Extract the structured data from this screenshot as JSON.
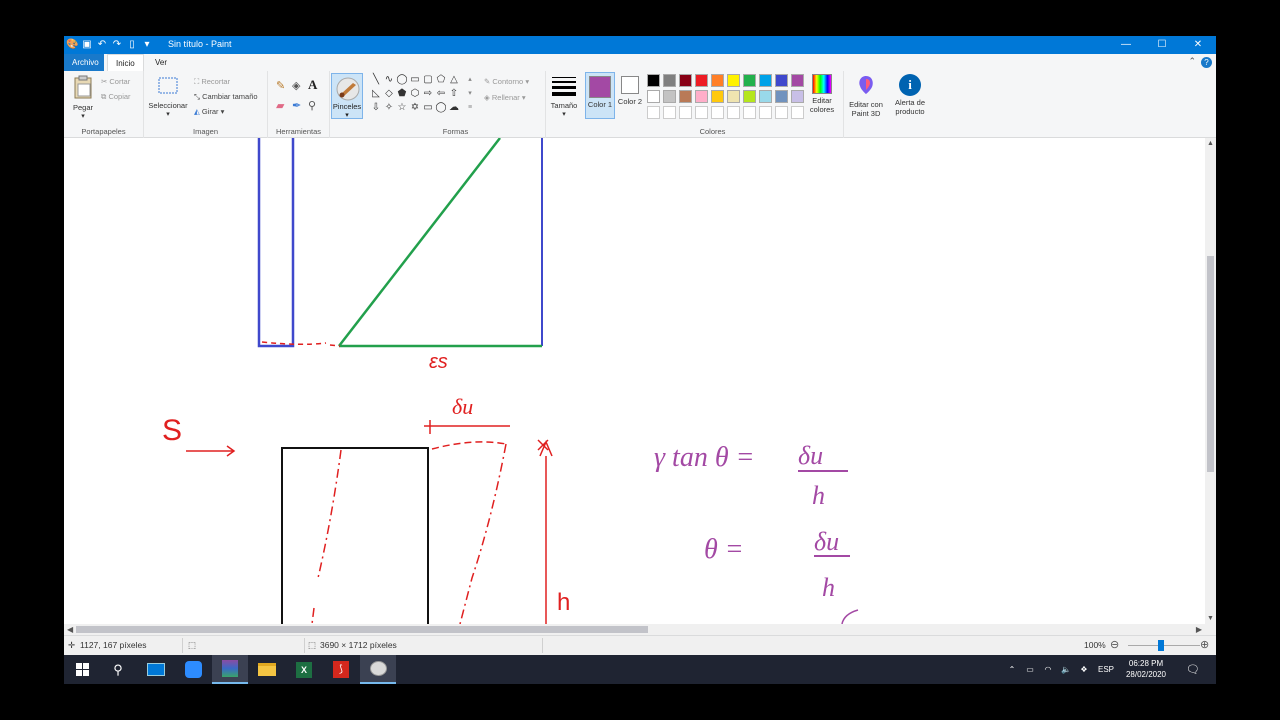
{
  "window": {
    "title": "Sin título - Paint",
    "buttons": {
      "minimize": "—",
      "maximize": "☐",
      "close": "✕"
    }
  },
  "tabs": {
    "file": "Archivo",
    "home": "Inicio",
    "view": "Ver"
  },
  "ribbon": {
    "clipboard": {
      "paste": "Pegar",
      "cut": "Cortar",
      "copy": "Copiar",
      "label": "Portapapeles"
    },
    "image": {
      "select": "Seleccionar",
      "crop": "Recortar",
      "resize": "Cambiar tamaño",
      "rotate": "Girar",
      "label": "Imagen"
    },
    "tools": {
      "label": "Herramientas",
      "brushes": "Pinceles"
    },
    "shapes": {
      "outline": "Contorno",
      "fill": "Rellenar",
      "label": "Formas"
    },
    "size": {
      "label": "Tamaño"
    },
    "colors": {
      "color1": "Color 1",
      "color2": "Color 2",
      "edit": "Editar colores",
      "label": "Colores",
      "color1_value": "#a349a4",
      "color2_value": "#ffffff",
      "palette_row1": [
        "#000000",
        "#7f7f7f",
        "#880015",
        "#ed1c24",
        "#ff7f27",
        "#fff200",
        "#22b14c",
        "#00a2e8",
        "#3f48cc",
        "#a349a4"
      ],
      "palette_row2": [
        "#ffffff",
        "#c3c3c3",
        "#b97a57",
        "#ffaec9",
        "#ffc90e",
        "#efe4b0",
        "#b5e61d",
        "#99d9ea",
        "#7092be",
        "#c8bfe7"
      ]
    },
    "paint3d": "Editar con Paint 3D",
    "product_alert": "Alerta de producto"
  },
  "canvas": {
    "labels": {
      "epsilon": "εs",
      "s": "S",
      "delta_top": "δu",
      "h_side": "h",
      "eq1_lhs": "γ tan θ =",
      "eq1_num": "δu",
      "eq1_den": "h",
      "eq2_lhs": "θ =",
      "eq2_num": "δu",
      "eq2_den": "h"
    }
  },
  "statusbar": {
    "cursor_pos": "1127, 167 píxeles",
    "image_size": "3690 × 1712 píxeles",
    "zoom": "100%"
  },
  "taskbar": {
    "lang": "ESP",
    "time": "06:28 PM",
    "date": "28/02/2020"
  }
}
